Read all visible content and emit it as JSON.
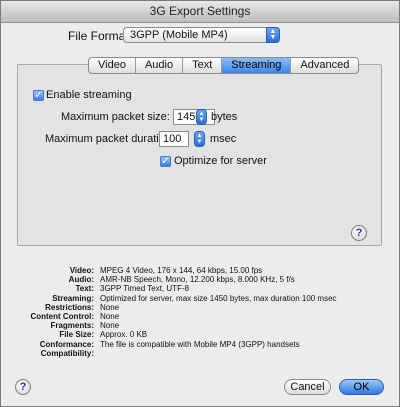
{
  "window": {
    "title": "3G Export Settings"
  },
  "format": {
    "label": "File Format:",
    "value": "3GPP (Mobile MP4)"
  },
  "tabs": [
    {
      "label": "Video",
      "active": false
    },
    {
      "label": "Audio",
      "active": false
    },
    {
      "label": "Text",
      "active": false
    },
    {
      "label": "Streaming",
      "active": true
    },
    {
      "label": "Advanced",
      "active": false
    }
  ],
  "streaming": {
    "enable_label": "Enable streaming",
    "enable_checked": true,
    "packet_size_label": "Maximum packet size:",
    "packet_size_value": "1450",
    "packet_size_unit": "bytes",
    "packet_duration_label": "Maximum packet duration:",
    "packet_duration_value": "100",
    "packet_duration_unit": "msec",
    "optimize_label": "Optimize for server",
    "optimize_checked": true
  },
  "summary": [
    {
      "key": "Video:",
      "value": "MPEG 4 Video, 176 x 144, 64 kbps, 15.00 fps"
    },
    {
      "key": "Audio:",
      "value": "AMR-NB Speech, Mono, 12.200 kbps, 8.000 KHz, 5 f/s"
    },
    {
      "key": "Text:",
      "value": "3GPP Timed Text, UTF-8"
    },
    {
      "key": "Streaming:",
      "value": "Optimized for server, max size 1450 bytes, max duration 100 msec"
    },
    {
      "key": "Restrictions:",
      "value": "None"
    },
    {
      "key": "Content Control:",
      "value": "None"
    },
    {
      "key": "Fragments:",
      "value": "None"
    },
    {
      "key": "File Size:",
      "value": "Approx. 0 KB"
    },
    {
      "key": "Conformance:",
      "value": "The file is compatible with Mobile MP4 (3GPP) handsets"
    },
    {
      "key": "Compatibility:",
      "value": ""
    }
  ],
  "buttons": {
    "cancel": "Cancel",
    "ok": "OK"
  },
  "icons": {
    "help": "?",
    "check": "✓"
  }
}
